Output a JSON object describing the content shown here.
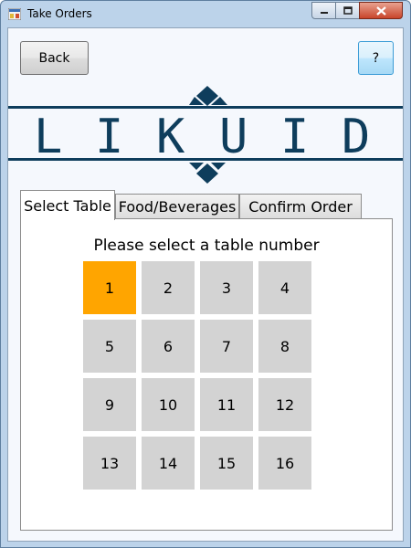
{
  "window": {
    "title": "Take Orders"
  },
  "toolbar": {
    "back_label": "Back",
    "help_label": "?"
  },
  "logo": {
    "letters": [
      "L",
      "I",
      "K",
      "U",
      "I",
      "D"
    ],
    "color": "#0e3d5c"
  },
  "tabs": [
    {
      "label": "Select Table",
      "active": true
    },
    {
      "label": "Food/Beverages",
      "active": false
    },
    {
      "label": "Confirm Order",
      "active": false
    }
  ],
  "select_table": {
    "prompt": "Please select a table number",
    "selected": "1",
    "selected_color": "#ffa500",
    "default_color": "#d3d3d3",
    "tables": [
      "1",
      "2",
      "3",
      "4",
      "5",
      "6",
      "7",
      "8",
      "9",
      "10",
      "11",
      "12",
      "13",
      "14",
      "15",
      "16"
    ]
  }
}
